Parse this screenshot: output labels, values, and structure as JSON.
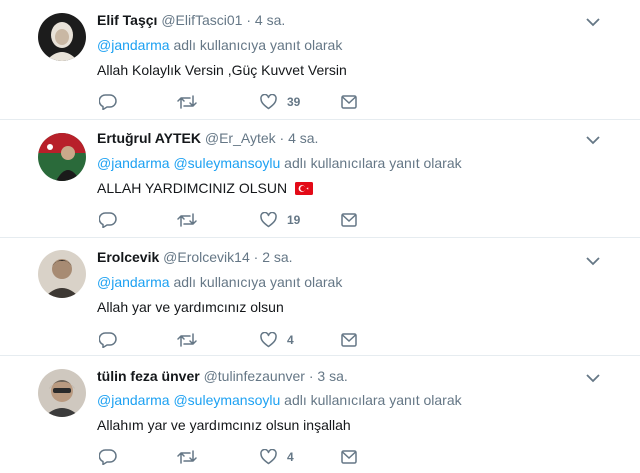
{
  "tweets": [
    {
      "name": "Elif Taşçı",
      "handle": "@ElifTasci01",
      "sep": "·",
      "time": "4 sa.",
      "mentions": [
        "@jandarma"
      ],
      "reply_suffix": "adlı kullanıcıya yanıt olarak",
      "text": "Allah Kolaylık Versin ,Güç Kuvvet Versin",
      "likes": "39",
      "avatar_colors": [
        "#1c1c1c",
        "#e8e2d8"
      ]
    },
    {
      "name": "Ertuğrul AYTEK",
      "handle": "@Er_Aytek",
      "sep": "·",
      "time": "4 sa.",
      "mentions": [
        "@jandarma",
        "@suleymansoylu"
      ],
      "reply_suffix": "adlı kullanıcılara yanıt olarak",
      "text": "ALLAH YARDIMCINIZ OLSUN",
      "likes": "19",
      "avatar_colors": [
        "#b8202a",
        "#2a6a3a"
      ]
    },
    {
      "name": "Erolcevik",
      "handle": "@Erolcevik14",
      "sep": "·",
      "time": "2 sa.",
      "mentions": [
        "@jandarma"
      ],
      "reply_suffix": "adlı kullanıcıya yanıt olarak",
      "text": "Allah yar ve yardımcınız olsun",
      "likes": "4",
      "avatar_colors": [
        "#5a5148",
        "#d9d2c8"
      ]
    },
    {
      "name": "tülin feza ünver",
      "handle": "@tulinfezaunver",
      "sep": "·",
      "time": "3 sa.",
      "mentions": [
        "@jandarma",
        "@suleymansoylu"
      ],
      "reply_suffix": "adlı kullanıcılara yanıt olarak",
      "text": "Allahım yar ve yardımcınız olsun inşallah",
      "likes": "4",
      "avatar_colors": [
        "#3b3b3b",
        "#cfc8bf"
      ]
    }
  ],
  "colors": {
    "accent": "#1da1f2",
    "muted": "#657786",
    "text": "#14171a",
    "border": "#e6ecf0",
    "flag": "#e30a17"
  }
}
